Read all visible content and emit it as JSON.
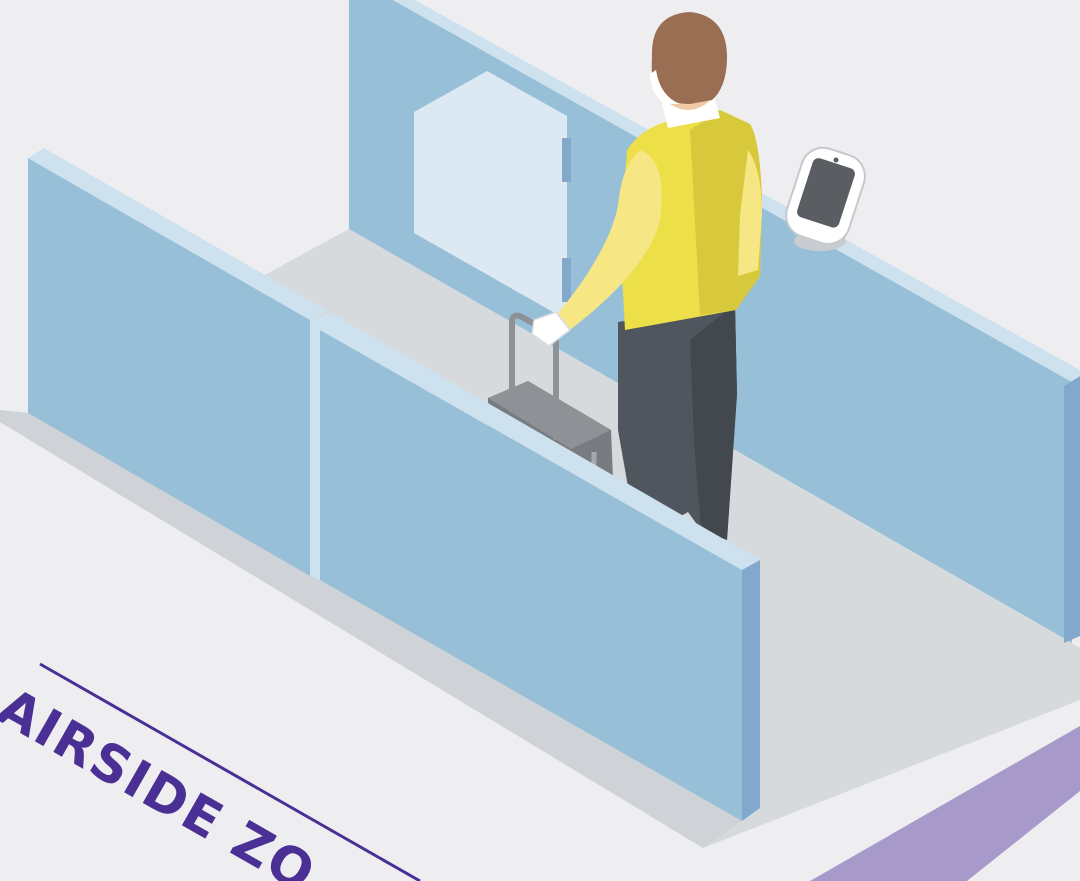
{
  "scene": {
    "zone_label": "AIRSIDE ZO",
    "colors": {
      "background": "#eeeef1",
      "floor": "#d7dadd",
      "floor_shadow": "#cfd3d7",
      "glass_panel": "#97bfd8",
      "glass_edge": "#cde2ee",
      "glass_side": "#82a9cb",
      "door": "#dde9f2",
      "zone_text": "#4a2f94",
      "zone_band": "#a79acb",
      "jacket": "#ecdf47",
      "jacket_shadow": "#d8c93c",
      "sleeve_light": "#f6e684",
      "trousers": "#4f565d",
      "hair": "#9a6e52",
      "suitcase": "#787c80"
    },
    "icons": [
      "traveler-figure",
      "suitcase-icon",
      "biometric-scanner-icon",
      "security-gate-icon"
    ]
  }
}
